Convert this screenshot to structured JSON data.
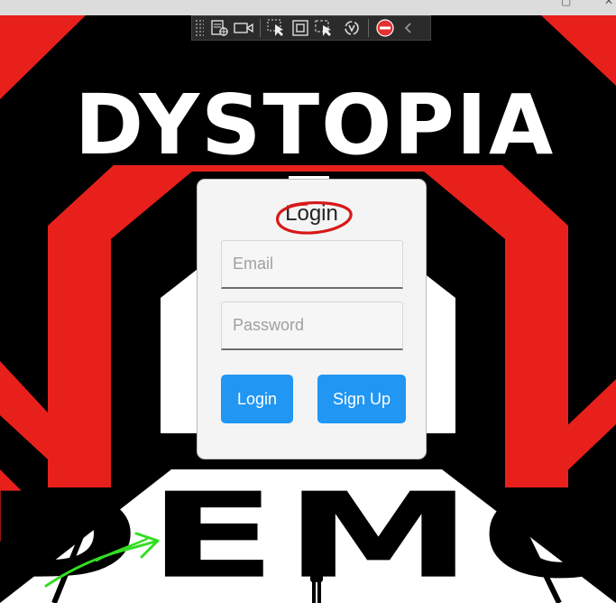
{
  "window": {
    "minimize_icon": "window-restore-icon",
    "close_icon": "close-icon"
  },
  "background": {
    "logo_top": "DYSTOPIA",
    "logo_bottom": "DEMO",
    "colors": {
      "red": "#e8201c",
      "black": "#000000",
      "white": "#ffffff"
    }
  },
  "debug_toolbar": {
    "icons": [
      "live-tree-icon",
      "video-icon",
      "select-element-icon",
      "layout-adorners-icon",
      "track-focus-icon",
      "hot-reload-icon",
      "stop-icon",
      "collapse-chevron-icon"
    ]
  },
  "login": {
    "title": "Login",
    "email_placeholder": "Email",
    "password_placeholder": "Password",
    "login_button": "Login",
    "signup_button": "Sign Up",
    "accent_color": "#2196f3"
  },
  "annotations": {
    "circle_color": "#d81818",
    "arrow_color": "#33dd22"
  }
}
